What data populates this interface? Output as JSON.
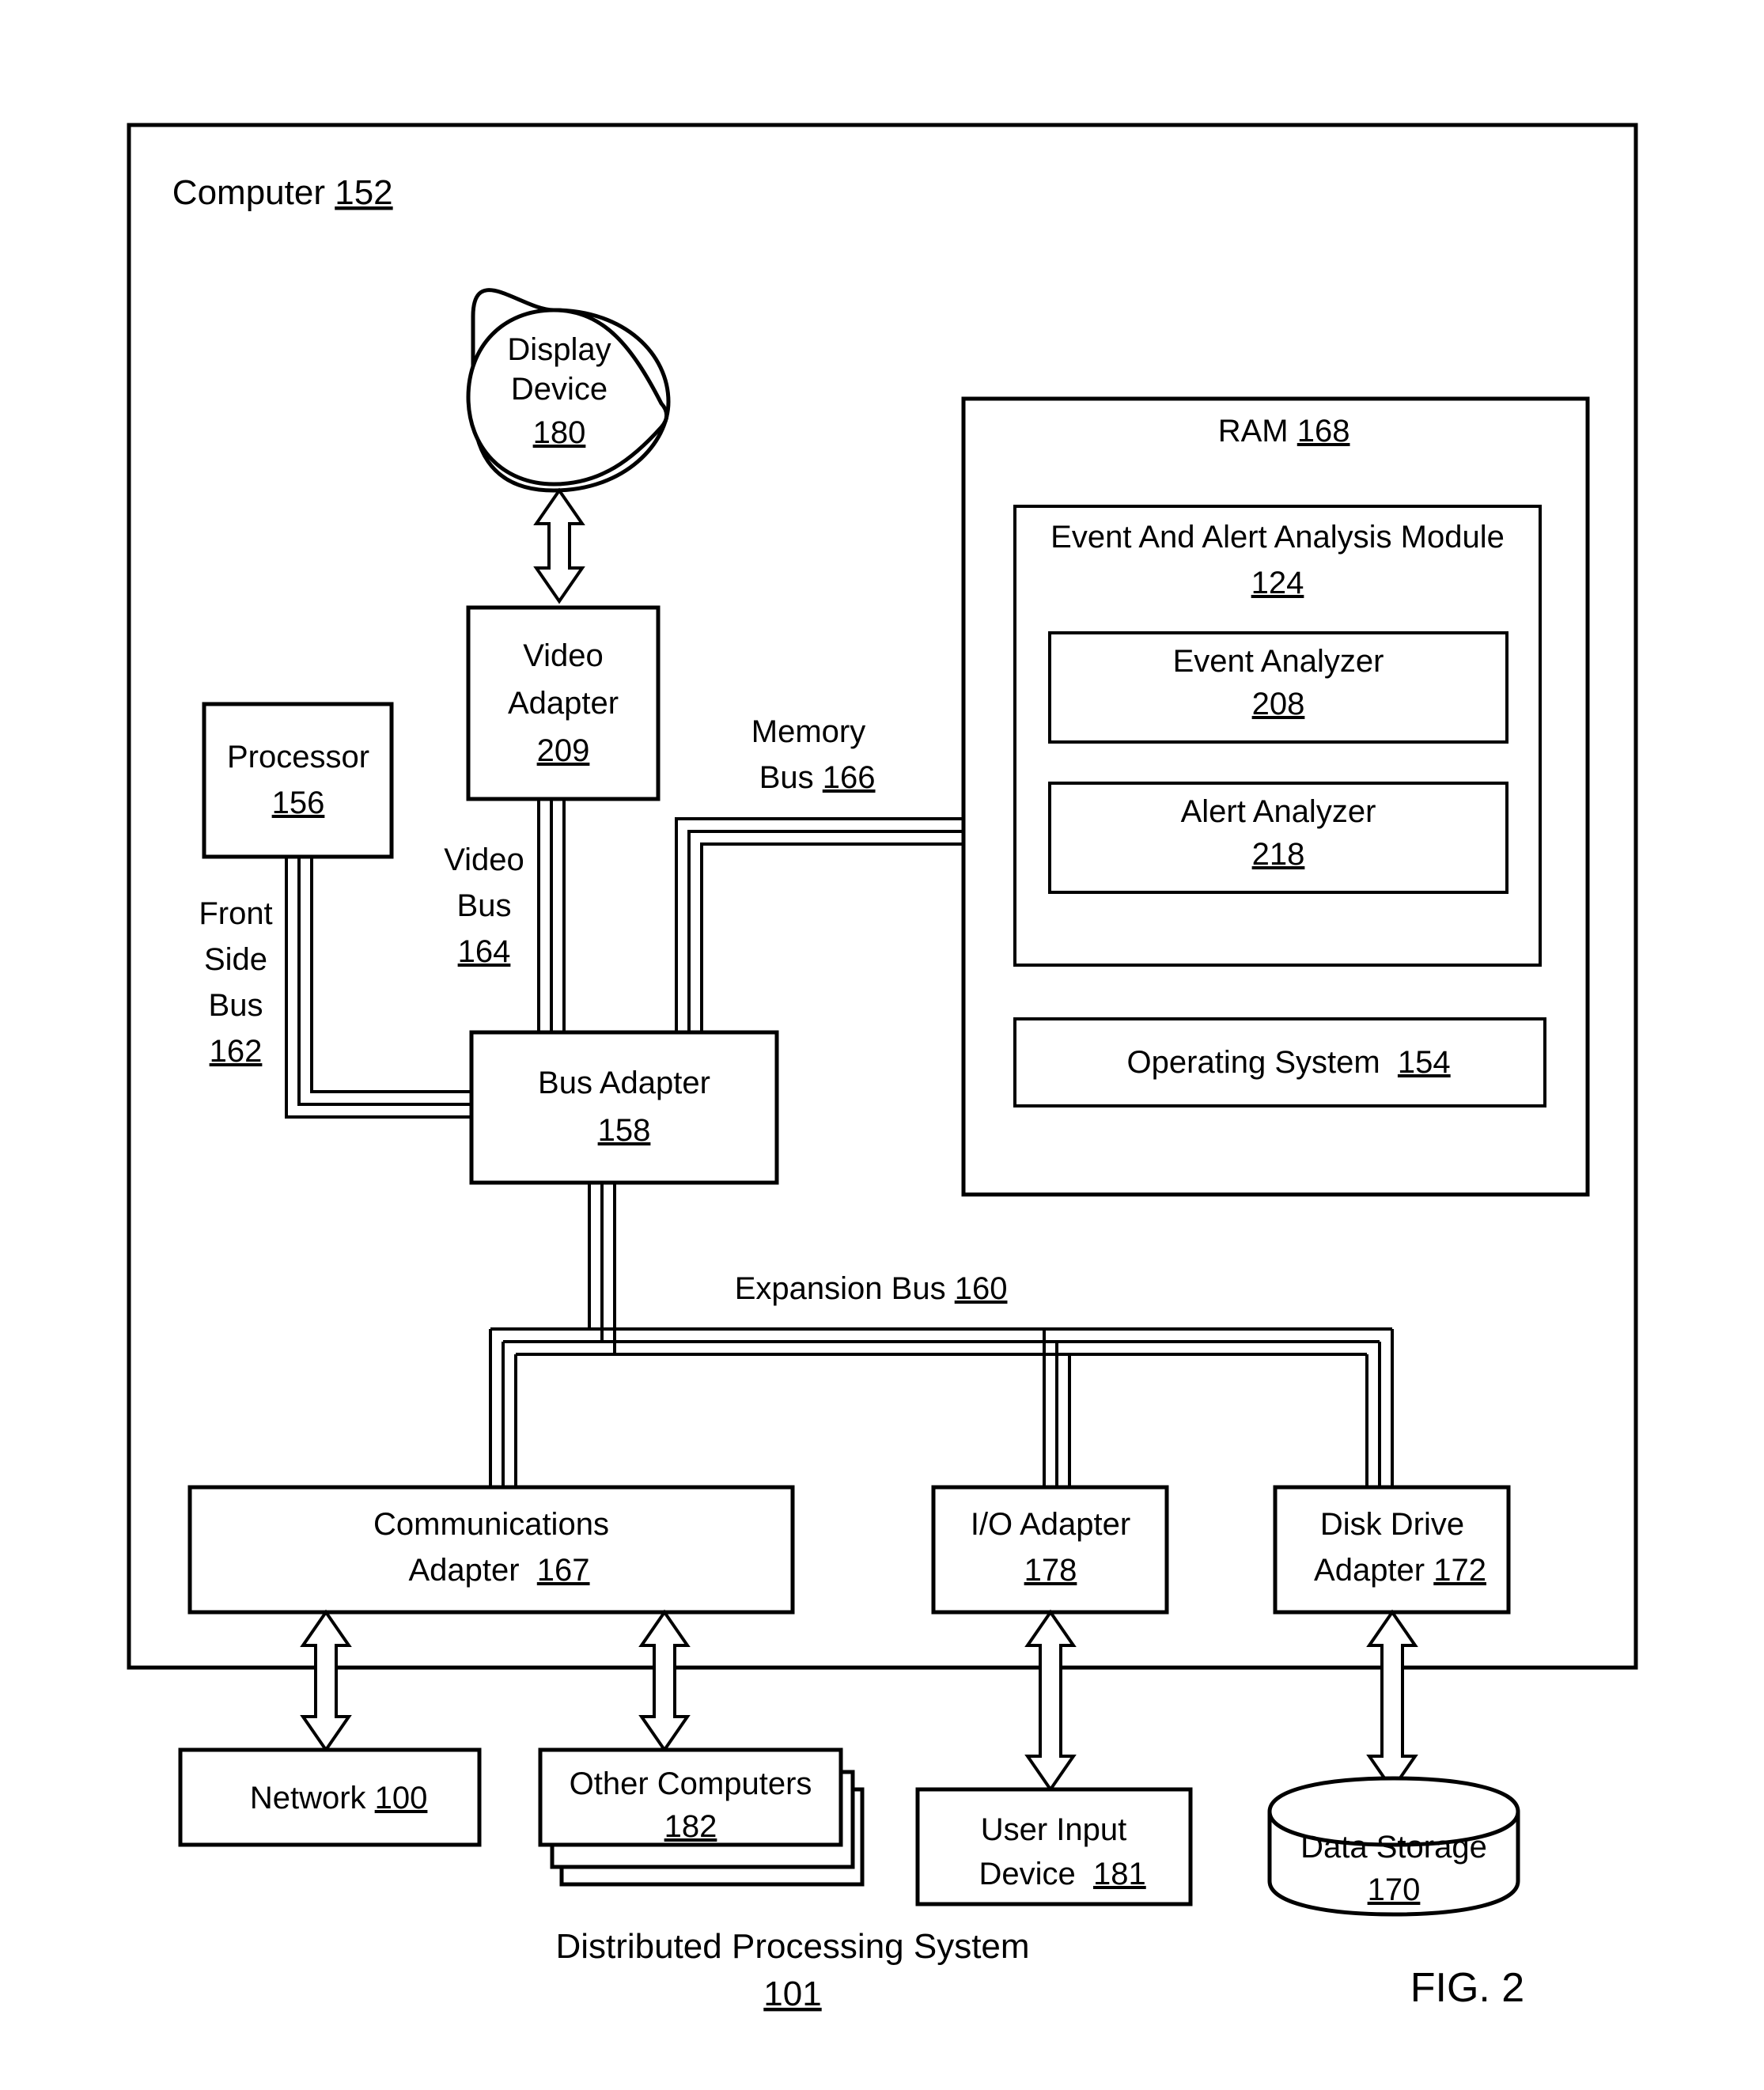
{
  "figure": {
    "label": "FIG. 2",
    "caption_line1": "Distributed Processing System",
    "caption_ref": "101"
  },
  "computer": {
    "title": "Computer",
    "ref": "152"
  },
  "display_device": {
    "line1": "Display",
    "line2": "Device",
    "ref": "180"
  },
  "video_adapter": {
    "line1": "Video",
    "line2": "Adapter",
    "ref": "209"
  },
  "processor": {
    "line1": "Processor",
    "ref": "156"
  },
  "bus_adapter": {
    "line1": "Bus Adapter",
    "ref": "158"
  },
  "ram": {
    "title": "RAM",
    "ref": "168",
    "module": {
      "line1": "Event And Alert Analysis Module",
      "ref": "124",
      "event_analyzer": {
        "line1": "Event Analyzer",
        "ref": "208"
      },
      "alert_analyzer": {
        "line1": "Alert Analyzer",
        "ref": "218"
      }
    },
    "operating_system": {
      "line1": "Operating System",
      "ref": "154"
    }
  },
  "buses": {
    "front_side": {
      "l1": "Front",
      "l2": "Side",
      "l3": "Bus",
      "ref": "162"
    },
    "video": {
      "l1": "Video",
      "l2": "Bus",
      "ref": "164"
    },
    "memory": {
      "l1": "Memory",
      "l2": "Bus",
      "ref": "166"
    },
    "expansion": {
      "l1": "Expansion Bus",
      "ref": "160"
    }
  },
  "communications_adapter": {
    "line1": "Communications",
    "line2": "Adapter",
    "ref": "167"
  },
  "io_adapter": {
    "line1": "I/O Adapter",
    "ref": "178"
  },
  "disk_drive_adapter": {
    "line1": "Disk Drive",
    "line2": "Adapter",
    "ref": "172"
  },
  "network": {
    "line1": "Network",
    "ref": "100"
  },
  "other_computers": {
    "line1": "Other Computers",
    "ref": "182"
  },
  "user_input_device": {
    "line1": "User Input",
    "line2": "Device",
    "ref": "181"
  },
  "data_storage": {
    "line1": "Data Storage",
    "ref": "170"
  }
}
